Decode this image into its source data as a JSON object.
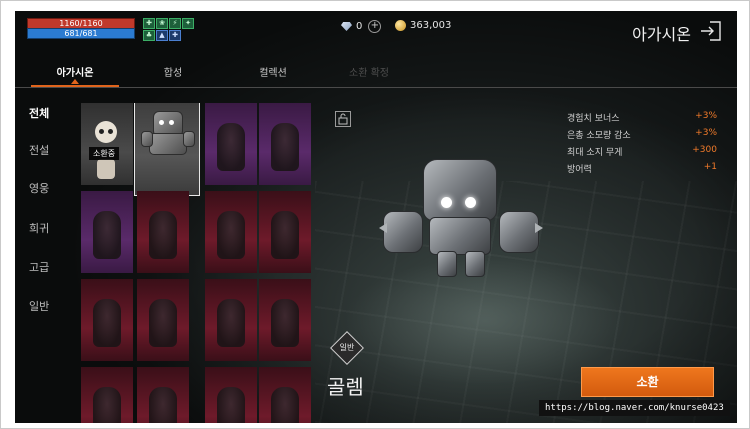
{
  "status": {
    "hp": "1160/1160",
    "mp": "681/681",
    "buffs": [
      "✚",
      "❀",
      "⚡",
      "✦",
      "♣",
      "▲",
      "✚"
    ]
  },
  "currency": {
    "gems": "0",
    "gold": "363,003",
    "gem_icon": "diamond-icon",
    "gold_icon": "coin-icon"
  },
  "header": {
    "title": "아가시온",
    "exit_icon": "exit-icon"
  },
  "tabs": [
    {
      "label": "아가시온",
      "active": true
    },
    {
      "label": "합성",
      "active": false
    },
    {
      "label": "컬렉션",
      "active": false
    },
    {
      "label": "소환 확정",
      "active": false,
      "disabled": true
    }
  ],
  "categories": [
    "전체",
    "전설",
    "영웅",
    "희귀",
    "고급",
    "일반"
  ],
  "grid": {
    "summon_badge": "소환중"
  },
  "stats": [
    {
      "label": "경험치 보너스",
      "value": "+3%"
    },
    {
      "label": "은총 소모량 감소",
      "value": "+3%"
    },
    {
      "label": "최대 소지 무게",
      "value": "+300"
    },
    {
      "label": "방어력",
      "value": "+1"
    }
  ],
  "character": {
    "rank": "일반",
    "name": "골렘"
  },
  "actions": {
    "summon_label": "소환"
  },
  "watermark": "https://blog.naver.com/knurse0423",
  "colors": {
    "accent": "#e0641c",
    "stat_value": "#f07a2a",
    "hp": "#c0392b",
    "mp": "#2b7bd1"
  }
}
